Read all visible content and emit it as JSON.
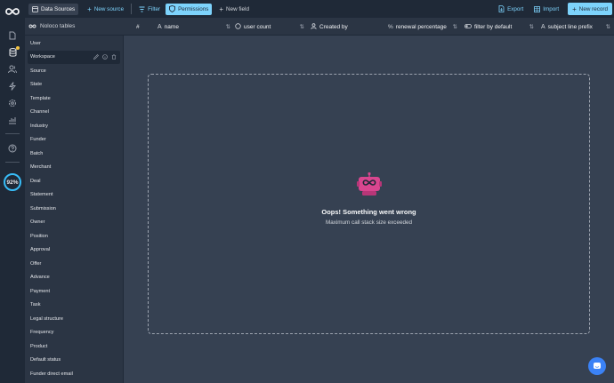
{
  "toolbar": {
    "data_sources": "Data Sources",
    "new_source": "New source",
    "filter": "Filter",
    "permissions": "Permissions",
    "new_field": "New field",
    "export": "Export",
    "import": "Import",
    "new_record": "New record"
  },
  "rail": {
    "progress": "92%"
  },
  "sidebar": {
    "title": "Noloco tables",
    "items": [
      "User",
      "Workspace",
      "Source",
      "State",
      "Template",
      "Channel",
      "Industry",
      "Funder",
      "Batch",
      "Merchant",
      "Deal",
      "Statement",
      "Submission",
      "Owner",
      "Position",
      "Approval",
      "Offer",
      "Advance",
      "Payment",
      "Task",
      "Legal structure",
      "Frequency",
      "Product",
      "Default status",
      "Funder direct email"
    ],
    "active_item": "Workspace"
  },
  "columns": {
    "hash": "#",
    "name": "name",
    "user_count": "user count",
    "created_by": "Created by",
    "renewal_percentage": "renewal percentage",
    "filter_by_default": "filter by default",
    "subject_line_prefix": "subject line prefix"
  },
  "error": {
    "title": "Oops! Something went wrong",
    "message": "Maximum call stack size exceeded"
  },
  "colors": {
    "accent": "#7dd3fc",
    "robot": "#d9468f",
    "dashed_border": "#9ca3af",
    "chat": "#3b82f6"
  }
}
